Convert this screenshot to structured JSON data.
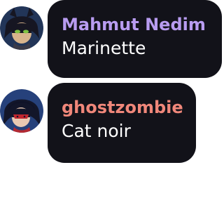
{
  "messages": [
    {
      "sender": "Mahmut Nedim",
      "text": "Marinette",
      "sender_color": "#b89cf0",
      "avatar_icon": "user-avatar-icon"
    },
    {
      "sender": "ghostzombie",
      "text": "Cat noir",
      "sender_color": "#f0877a",
      "avatar_icon": "user-avatar-icon"
    }
  ],
  "bubble_color": "#121219",
  "text_color": "#ffffff"
}
